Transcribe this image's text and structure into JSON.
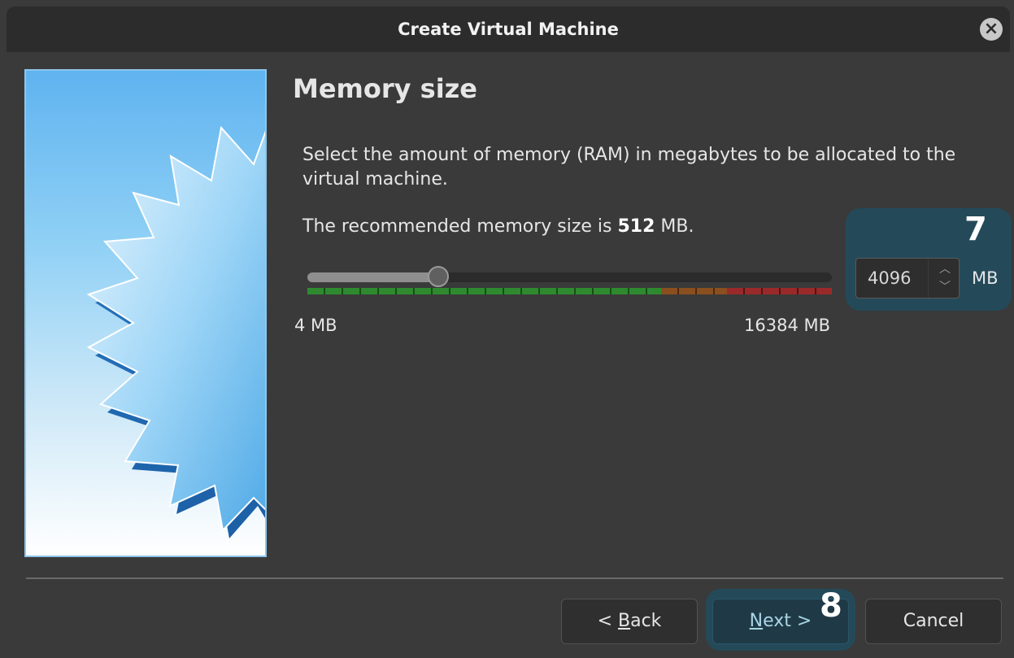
{
  "window": {
    "title": "Create Virtual Machine",
    "close_icon": "close-icon"
  },
  "page": {
    "title": "Memory size",
    "description": "Select the amount of memory (RAM) in megabytes to be allocated to the virtual machine.",
    "recommend_prefix": "The recommended memory size is ",
    "recommend_value": "512",
    "recommend_suffix": " MB."
  },
  "memory": {
    "min_label": "4 MB",
    "max_label": "16384 MB",
    "min_mb": 4,
    "max_mb": 16384,
    "value_mb": 4096,
    "spin_value": "4096",
    "unit": "MB",
    "slider_fraction": 0.25,
    "zones": {
      "green_end_fraction": 0.675,
      "orange_end_fraction": 0.8
    }
  },
  "annotations": {
    "badge_7": "7",
    "badge_8": "8"
  },
  "buttons": {
    "back_prefix": "< ",
    "back_mnemonic": "B",
    "back_rest": "ack",
    "next_mnemonic": "N",
    "next_rest": "ext >",
    "cancel": "Cancel"
  },
  "colors": {
    "highlight": "#244a5a",
    "slider_green": "#2f8a2f",
    "slider_orange": "#8a4f1f",
    "slider_red": "#9a2a2a"
  }
}
